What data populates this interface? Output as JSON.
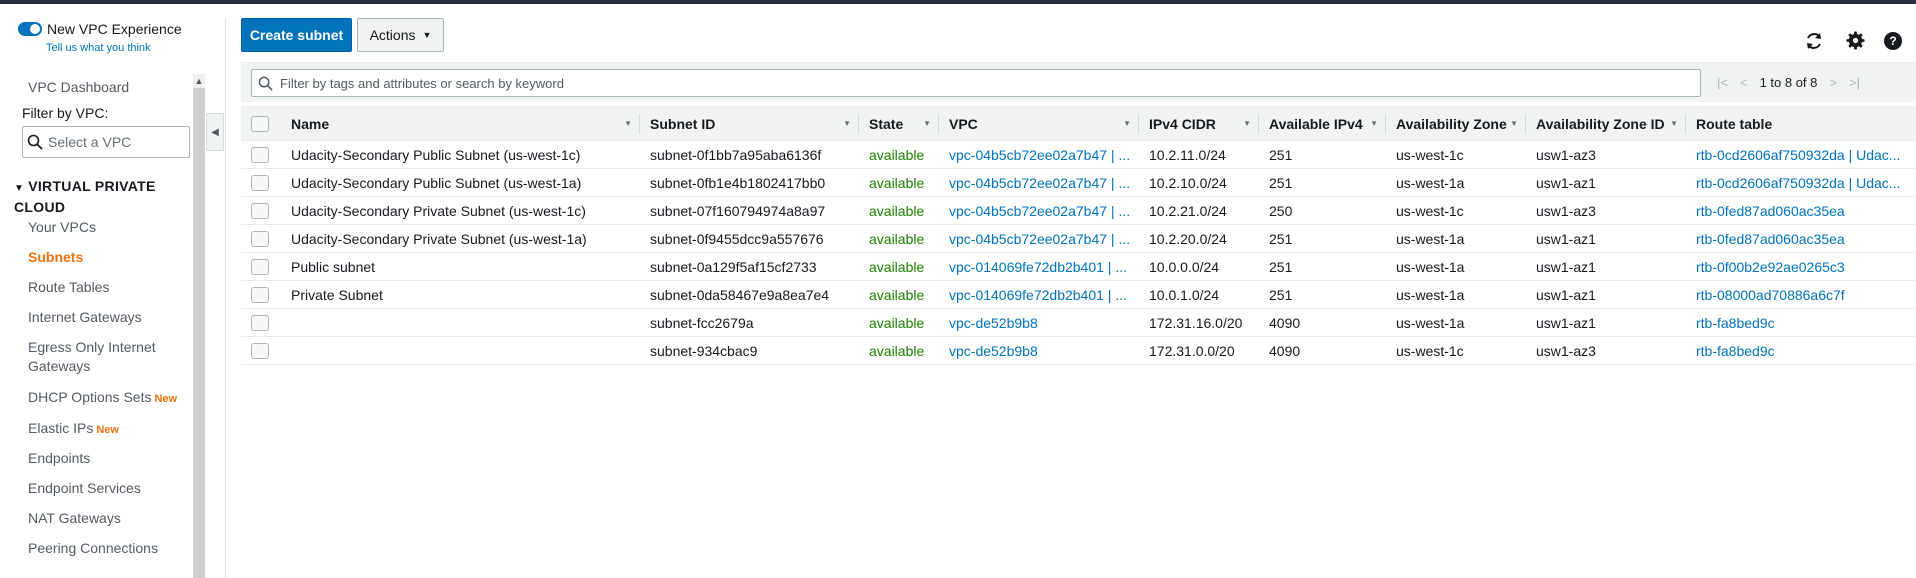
{
  "sidebar": {
    "toggle_label": "New VPC Experience",
    "tell_us": "Tell us what you think",
    "dashboard": "VPC Dashboard",
    "filter_label": "Filter by VPC:",
    "select_placeholder": "Select a VPC",
    "section_title_1": "VIRTUAL PRIVATE",
    "section_title_2": "CLOUD",
    "items": [
      {
        "label": "Your VPCs"
      },
      {
        "label": "Subnets",
        "active": true
      },
      {
        "label": "Route Tables"
      },
      {
        "label": "Internet Gateways"
      },
      {
        "label": "Egress Only Internet"
      },
      {
        "label": "Gateways"
      },
      {
        "label": "DHCP Options Sets",
        "badge": "New"
      },
      {
        "label": "Elastic IPs",
        "badge": "New"
      },
      {
        "label": "Endpoints"
      },
      {
        "label": "Endpoint Services"
      },
      {
        "label": "NAT Gateways"
      },
      {
        "label": "Peering Connections"
      }
    ]
  },
  "toolbar": {
    "create_label": "Create subnet",
    "actions_label": "Actions",
    "refresh_icon": "refresh-icon",
    "settings_icon": "gear-icon",
    "help_icon": "help-icon",
    "help_glyph": "?"
  },
  "search": {
    "placeholder": "Filter by tags and attributes or search by keyword"
  },
  "pager": {
    "text": "1 to 8 of 8"
  },
  "table": {
    "columns": [
      "Name",
      "Subnet ID",
      "State",
      "VPC",
      "IPv4 CIDR",
      "Available IPv4",
      "Availability Zone",
      "Availability Zone ID",
      "Route table"
    ],
    "rows": [
      [
        "Udacity-Secondary Public Subnet (us-west-1c)",
        "subnet-0f1bb7a95aba6136f",
        "available",
        "vpc-04b5cb72ee02a7b47 | ...",
        "10.2.11.0/24",
        "251",
        "us-west-1c",
        "usw1-az3",
        "rtb-0cd2606af750932da | Udac..."
      ],
      [
        "Udacity-Secondary Public Subnet (us-west-1a)",
        "subnet-0fb1e4b1802417bb0",
        "available",
        "vpc-04b5cb72ee02a7b47 | ...",
        "10.2.10.0/24",
        "251",
        "us-west-1a",
        "usw1-az1",
        "rtb-0cd2606af750932da | Udac..."
      ],
      [
        "Udacity-Secondary Private Subnet (us-west-1c)",
        "subnet-07f160794974a8a97",
        "available",
        "vpc-04b5cb72ee02a7b47 | ...",
        "10.2.21.0/24",
        "250",
        "us-west-1c",
        "usw1-az3",
        "rtb-0fed87ad060ac35ea"
      ],
      [
        "Udacity-Secondary Private Subnet (us-west-1a)",
        "subnet-0f9455dcc9a557676",
        "available",
        "vpc-04b5cb72ee02a7b47 | ...",
        "10.2.20.0/24",
        "251",
        "us-west-1a",
        "usw1-az1",
        "rtb-0fed87ad060ac35ea"
      ],
      [
        "Public subnet",
        "subnet-0a129f5af15cf2733",
        "available",
        "vpc-014069fe72db2b401 | ...",
        "10.0.0.0/24",
        "251",
        "us-west-1a",
        "usw1-az1",
        "rtb-0f00b2e92ae0265c3"
      ],
      [
        "Private Subnet",
        "subnet-0da58467e9a8ea7e4",
        "available",
        "vpc-014069fe72db2b401 | ...",
        "10.0.1.0/24",
        "251",
        "us-west-1a",
        "usw1-az1",
        "rtb-08000ad70886a6c7f"
      ],
      [
        "",
        "subnet-fcc2679a",
        "available",
        "vpc-de52b9b8",
        "172.31.16.0/20",
        "4090",
        "us-west-1a",
        "usw1-az1",
        "rtb-fa8bed9c"
      ],
      [
        "",
        "subnet-934cbac9",
        "available",
        "vpc-de52b9b8",
        "172.31.0.0/20",
        "4090",
        "us-west-1c",
        "usw1-az3",
        "rtb-fa8bed9c"
      ]
    ]
  }
}
